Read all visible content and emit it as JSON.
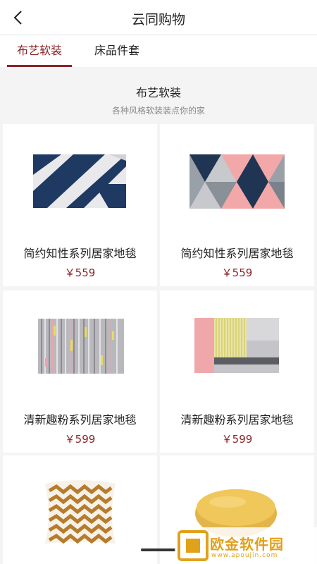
{
  "header": {
    "title": "云同购物"
  },
  "tabs": [
    {
      "label": "布艺软装",
      "active": true
    },
    {
      "label": "床品件套",
      "active": false
    }
  ],
  "section": {
    "title": "布艺软装",
    "subtitle": "各种风格软装装点你的家"
  },
  "products": [
    {
      "name": "简约知性系列居家地毯",
      "price": "￥559",
      "image": "navy-white-geometric-rug"
    },
    {
      "name": "简约知性系列居家地毯",
      "price": "￥559",
      "image": "pink-gray-triangle-rug"
    },
    {
      "name": "清新趣粉系列居家地毯",
      "price": "￥599",
      "image": "striped-gray-rug"
    },
    {
      "name": "清新趣粉系列居家地毯",
      "price": "￥599",
      "image": "pink-gray-yellow-block-rug"
    },
    {
      "name": "",
      "price": "",
      "image": "chevron-cushion"
    },
    {
      "name": "",
      "price": "",
      "image": "round-yellow-cushion"
    }
  ],
  "watermark": {
    "logo_text": "欧金软件园",
    "url": "www.apoujin.com"
  },
  "colors": {
    "accent": "#8a2326",
    "background": "#f5f4f4"
  }
}
